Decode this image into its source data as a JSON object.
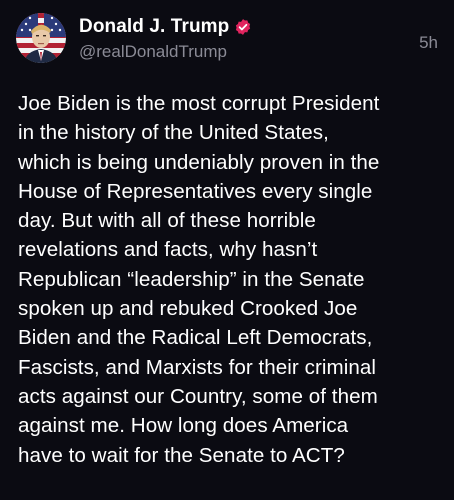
{
  "author": {
    "display_name": "Donald J. Trump",
    "handle": "@realDonaldTrump",
    "verified_icon": "verified-badge-icon",
    "avatar": "avatar-portrait-flag"
  },
  "post": {
    "timestamp": "5h",
    "text": "Joe Biden is the most corrupt President\nin the history of the United States,\nwhich is being undeniably proven in the\nHouse of Representatives every single\nday. But with all of these horrible\nrevelations and facts, why hasn’t\nRepublican “leadership” in the Senate\nspoken up and rebuked Crooked Joe\nBiden and the Radical Left Democrats,\nFascists, and Marxists for their criminal\nacts against our Country, some of them\nagainst me. How long does America\nhave to wait for the Senate to ACT?"
  },
  "colors": {
    "background": "#0b0b12",
    "text": "#ffffff",
    "muted": "#8b8b96",
    "verified": "#e0245e"
  }
}
